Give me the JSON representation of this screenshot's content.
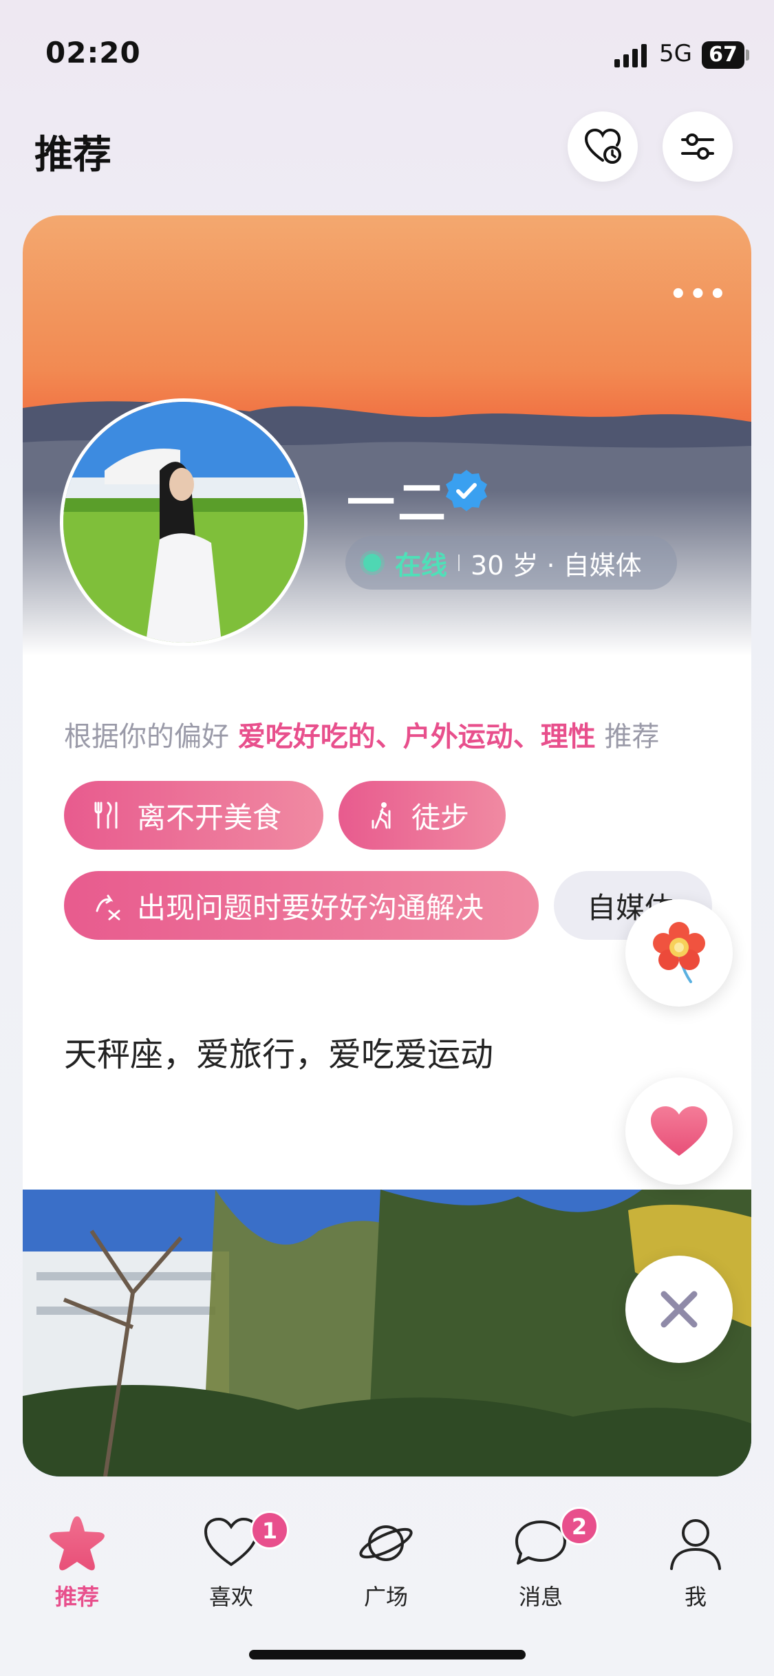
{
  "status_bar": {
    "time": "02:20",
    "network": "5G",
    "battery": "67"
  },
  "header": {
    "title": "推荐"
  },
  "profile": {
    "name": "一二",
    "status": "在线",
    "info": "30 岁 · 自媒体",
    "reason_prefix": "根据你的偏好",
    "reason_highlights": "爱吃好吃的、户外运动、理性",
    "reason_suffix": "推荐",
    "tags": [
      "离不开美食",
      "徒步",
      "出现问题时要好好沟通解决",
      "自媒体"
    ],
    "bio": "天秤座，爱旅行，爱吃爱运动"
  },
  "tab_bar": {
    "items": [
      {
        "label": "推荐",
        "icon": "star-icon",
        "active": true
      },
      {
        "label": "喜欢",
        "icon": "heart-icon",
        "badge": "1"
      },
      {
        "label": "广场",
        "icon": "planet-icon"
      },
      {
        "label": "消息",
        "icon": "chat-icon",
        "badge": "2"
      },
      {
        "label": "我",
        "icon": "user-icon"
      }
    ]
  },
  "colors": {
    "accent": "#e84f8c",
    "online": "#4fe0b8",
    "verified": "#3aa0f0"
  }
}
